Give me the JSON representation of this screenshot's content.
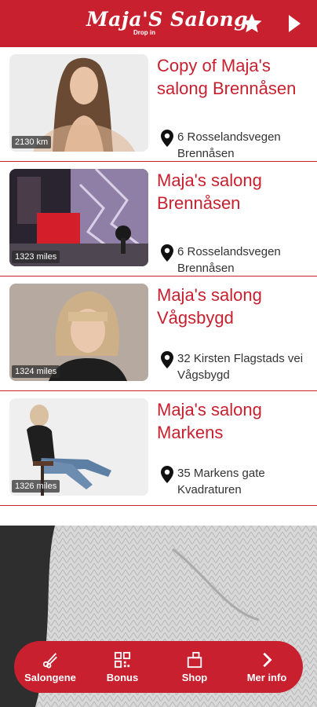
{
  "header": {
    "logo_text": "Maja'S Salong",
    "logo_sub": "Drop in",
    "star_icon": "star-icon",
    "forward_icon": "play-arrow-icon",
    "brand_color": "#c8202f"
  },
  "salons": [
    {
      "distance": "2130 km",
      "name": "Copy of Maja's salong Brennåsen",
      "address": "6 Rosselandsvegen Brennåsen"
    },
    {
      "distance": "1323 miles",
      "name": "Maja's salong Brennåsen",
      "address": "6 Rosselandsvegen Brennåsen"
    },
    {
      "distance": "1324 miles",
      "name": "Maja's salong Vågsbygd",
      "address": "32 Kirsten Flagstads vei Vågsbygd"
    },
    {
      "distance": "1326 miles",
      "name": "Maja's salong Markens",
      "address": "35 Markens gate Kvadraturen"
    }
  ],
  "nav": [
    {
      "label": "Salongene",
      "icon": "scissors-icon"
    },
    {
      "label": "Bonus",
      "icon": "qr-code-icon"
    },
    {
      "label": "Shop",
      "icon": "shop-bag-icon"
    },
    {
      "label": "Mer info",
      "icon": "chevron-right-icon"
    }
  ]
}
